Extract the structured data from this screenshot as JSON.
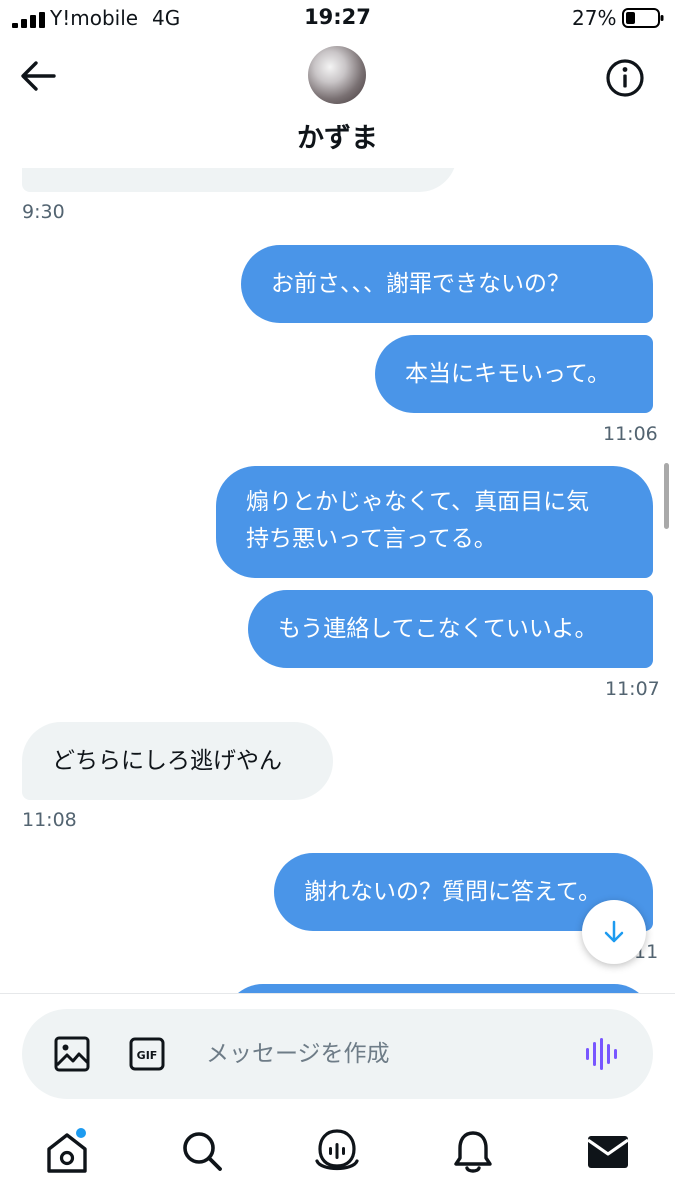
{
  "status_bar": {
    "carrier": "Y!mobile",
    "network": "4G",
    "time": "19:27",
    "battery_percent": "27%"
  },
  "header": {
    "contact_name": "かずま",
    "icons": {
      "back": "arrow-left-icon",
      "info": "info-icon"
    }
  },
  "messages": [
    {
      "direction": "in",
      "text": "",
      "partial": true
    },
    {
      "timestamp": "9:30",
      "side": "left"
    },
    {
      "direction": "out",
      "text": "お前さ、、、謝罪できないの？"
    },
    {
      "direction": "out",
      "text": "本当にキモいって。"
    },
    {
      "timestamp": "11:06",
      "side": "right"
    },
    {
      "direction": "out",
      "lines": [
        "煽りとかじゃなくて、真面目に気",
        "持ち悪いって言ってる。"
      ]
    },
    {
      "direction": "out",
      "text": "もう連絡してこなくていいよ。"
    },
    {
      "timestamp": "11:07",
      "side": "right"
    },
    {
      "direction": "in",
      "text": "どちらにしろ逃げやん"
    },
    {
      "timestamp": "11:08",
      "side": "left"
    },
    {
      "direction": "out",
      "text": "謝れないの？質問に答えて。"
    },
    {
      "timestamp": "11",
      "side": "right",
      "partial": true
    },
    {
      "direction": "out",
      "text": "",
      "partial": true
    }
  ],
  "composer": {
    "placeholder": "メッセージを作成",
    "icons": [
      "image-icon",
      "gif-icon",
      "voice-message-icon"
    ]
  },
  "tabbar": [
    "home-icon",
    "search-icon",
    "spaces-icon",
    "notifications-icon",
    "messages-icon"
  ],
  "colors": {
    "outgoing_bubble": "#4a95e8",
    "incoming_bubble": "#eff3f4",
    "accent": "#1d9bf0",
    "voice": "#7856ff"
  }
}
